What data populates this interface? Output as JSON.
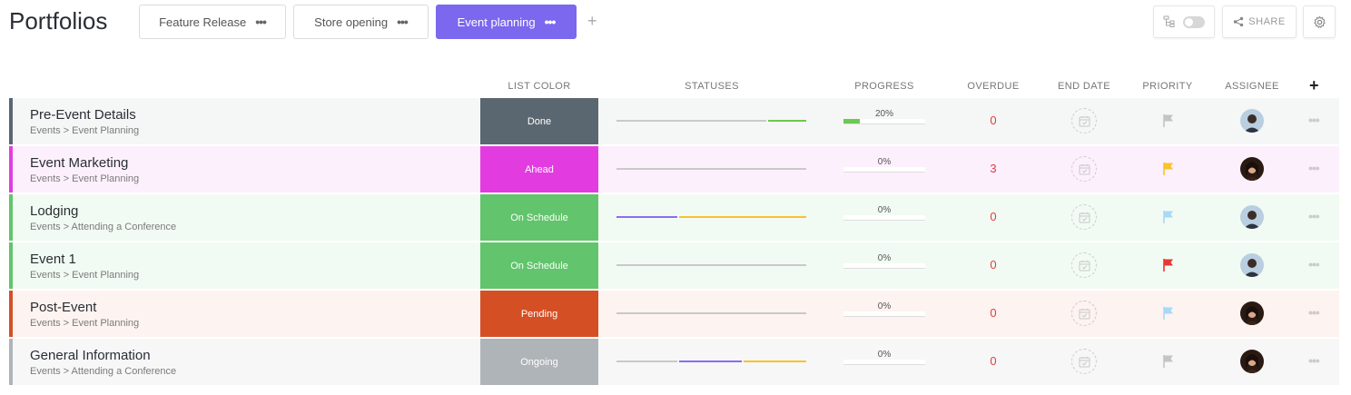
{
  "page_title": "Portfolios",
  "tabs": [
    {
      "label": "Feature Release",
      "active": false
    },
    {
      "label": "Store opening",
      "active": false
    },
    {
      "label": "Event planning",
      "active": true
    }
  ],
  "add_tab_label": "+",
  "toolbar": {
    "share_label": "SHARE"
  },
  "columns": {
    "list_color": "LIST COLOR",
    "statuses": "STATUSES",
    "progress": "PROGRESS",
    "overdue": "OVERDUE",
    "end_date": "END DATE",
    "priority": "PRIORITY",
    "assignee": "ASSIGNEE",
    "add": "+"
  },
  "rows": [
    {
      "name": "Pre-Event Details",
      "path": "Events > Event Planning",
      "list_color_label": "Done",
      "list_color": "#5b6770",
      "row_bg": "#f5f6f6",
      "progress": 20,
      "progress_label": "20%",
      "overdue": "0",
      "priority_color": "#c4c4c4",
      "assignee": "male",
      "status_segments": [
        {
          "color": "#c9c9c9",
          "share": 0.8
        },
        {
          "color": "#6bc950",
          "share": 0.2
        }
      ]
    },
    {
      "name": "Event Marketing",
      "path": "Events > Event Planning",
      "list_color_label": "Ahead",
      "list_color": "#e23ce0",
      "row_bg": "#fdf0fd",
      "progress": 0,
      "progress_label": "0%",
      "overdue": "3",
      "priority_color": "#f8c32b",
      "assignee": "female",
      "status_segments": [
        {
          "color": "#c9c9c9",
          "share": 1.0
        }
      ]
    },
    {
      "name": "Lodging",
      "path": "Events > Attending a Conference",
      "list_color_label": "On Schedule",
      "list_color": "#62c46c",
      "row_bg": "#f2fbf3",
      "progress": 0,
      "progress_label": "0%",
      "overdue": "0",
      "priority_color": "#a8daf7",
      "assignee": "male",
      "status_segments": [
        {
          "color": "#8b6cf0",
          "share": 0.33
        },
        {
          "color": "#f8c32b",
          "share": 0.67
        }
      ]
    },
    {
      "name": "Event 1",
      "path": "Events > Event Planning",
      "list_color_label": "On Schedule",
      "list_color": "#62c46c",
      "row_bg": "#f2fbf3",
      "progress": 0,
      "progress_label": "0%",
      "overdue": "0",
      "priority_color": "#e53935",
      "assignee": "male",
      "status_segments": [
        {
          "color": "#c9c9c9",
          "share": 1.0
        }
      ]
    },
    {
      "name": "Post-Event",
      "path": "Events > Event Planning",
      "list_color_label": "Pending",
      "list_color": "#d54f24",
      "row_bg": "#fdf3f0",
      "progress": 0,
      "progress_label": "0%",
      "overdue": "0",
      "priority_color": "#a8daf7",
      "assignee": "female",
      "status_segments": [
        {
          "color": "#c9c9c9",
          "share": 1.0
        }
      ]
    },
    {
      "name": "General Information",
      "path": "Events > Attending a Conference",
      "list_color_label": "Ongoing",
      "list_color": "#afb4b9",
      "row_bg": "#f7f7f8",
      "progress": 0,
      "progress_label": "0%",
      "overdue": "0",
      "priority_color": "#c4c4c4",
      "assignee": "female",
      "status_segments": [
        {
          "color": "#c9c9c9",
          "share": 0.33
        },
        {
          "color": "#8b6cf0",
          "share": 0.34
        },
        {
          "color": "#f8c32b",
          "share": 0.33
        }
      ]
    }
  ]
}
